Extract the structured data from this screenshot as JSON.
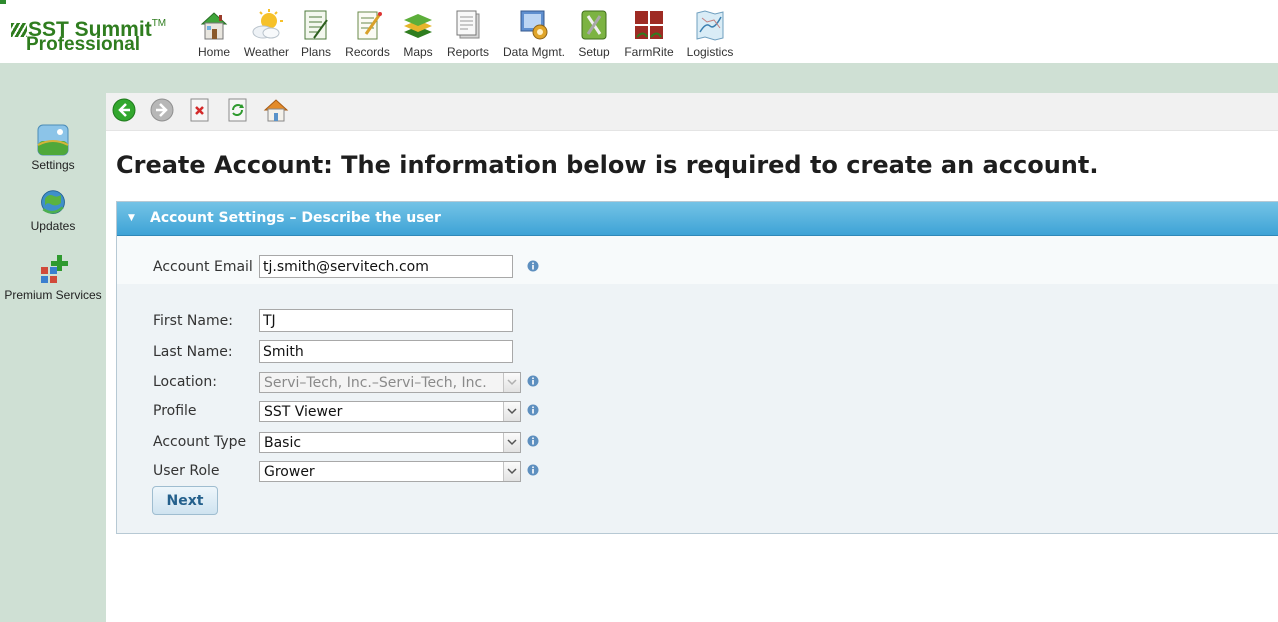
{
  "logo": {
    "line1": "SST Summit",
    "trademark": "TM",
    "line2": "Professional"
  },
  "top_nav": [
    {
      "label": "Home",
      "icon": "home-icon"
    },
    {
      "label": "Weather",
      "icon": "weather-icon"
    },
    {
      "label": "Plans",
      "icon": "plans-icon"
    },
    {
      "label": "Records",
      "icon": "records-icon"
    },
    {
      "label": "Maps",
      "icon": "maps-icon"
    },
    {
      "label": "Reports",
      "icon": "reports-icon"
    },
    {
      "label": "Data Mgmt.",
      "icon": "data-mgmt-icon"
    },
    {
      "label": "Setup",
      "icon": "setup-icon"
    },
    {
      "label": "FarmRite",
      "icon": "farmrite-icon"
    },
    {
      "label": "Logistics",
      "icon": "logistics-icon"
    }
  ],
  "sidebar": [
    {
      "label": "Settings",
      "icon": "settings-icon"
    },
    {
      "label": "Updates",
      "icon": "updates-icon"
    },
    {
      "label": "Premium Services",
      "icon": "premium-services-icon"
    }
  ],
  "nav_buttons": [
    "back-icon",
    "forward-icon",
    "close-icon",
    "refresh-icon",
    "home-icon"
  ],
  "page": {
    "title": "Create Account: The information below is required to create an account."
  },
  "panel": {
    "title": "Account Settings – Describe the user",
    "fields": {
      "email": {
        "label": "Account Email",
        "value": "tj.smith@servitech.com"
      },
      "first_name": {
        "label": "First Name:",
        "value": "TJ"
      },
      "last_name": {
        "label": "Last Name:",
        "value": "Smith"
      },
      "location": {
        "label": "Location:",
        "value": "Servi–Tech, Inc.–Servi–Tech, Inc."
      },
      "profile": {
        "label": "Profile",
        "value": "SST Viewer"
      },
      "account_type": {
        "label": "Account Type",
        "value": "Basic"
      },
      "user_role": {
        "label": "User Role",
        "value": "Grower"
      }
    },
    "next_label": "Next"
  },
  "colors": {
    "brand_green": "#2f7d1f",
    "sidebar_bg": "#cfe0d4",
    "panel_header": "#3ea3d6",
    "button_text": "#24608c"
  }
}
